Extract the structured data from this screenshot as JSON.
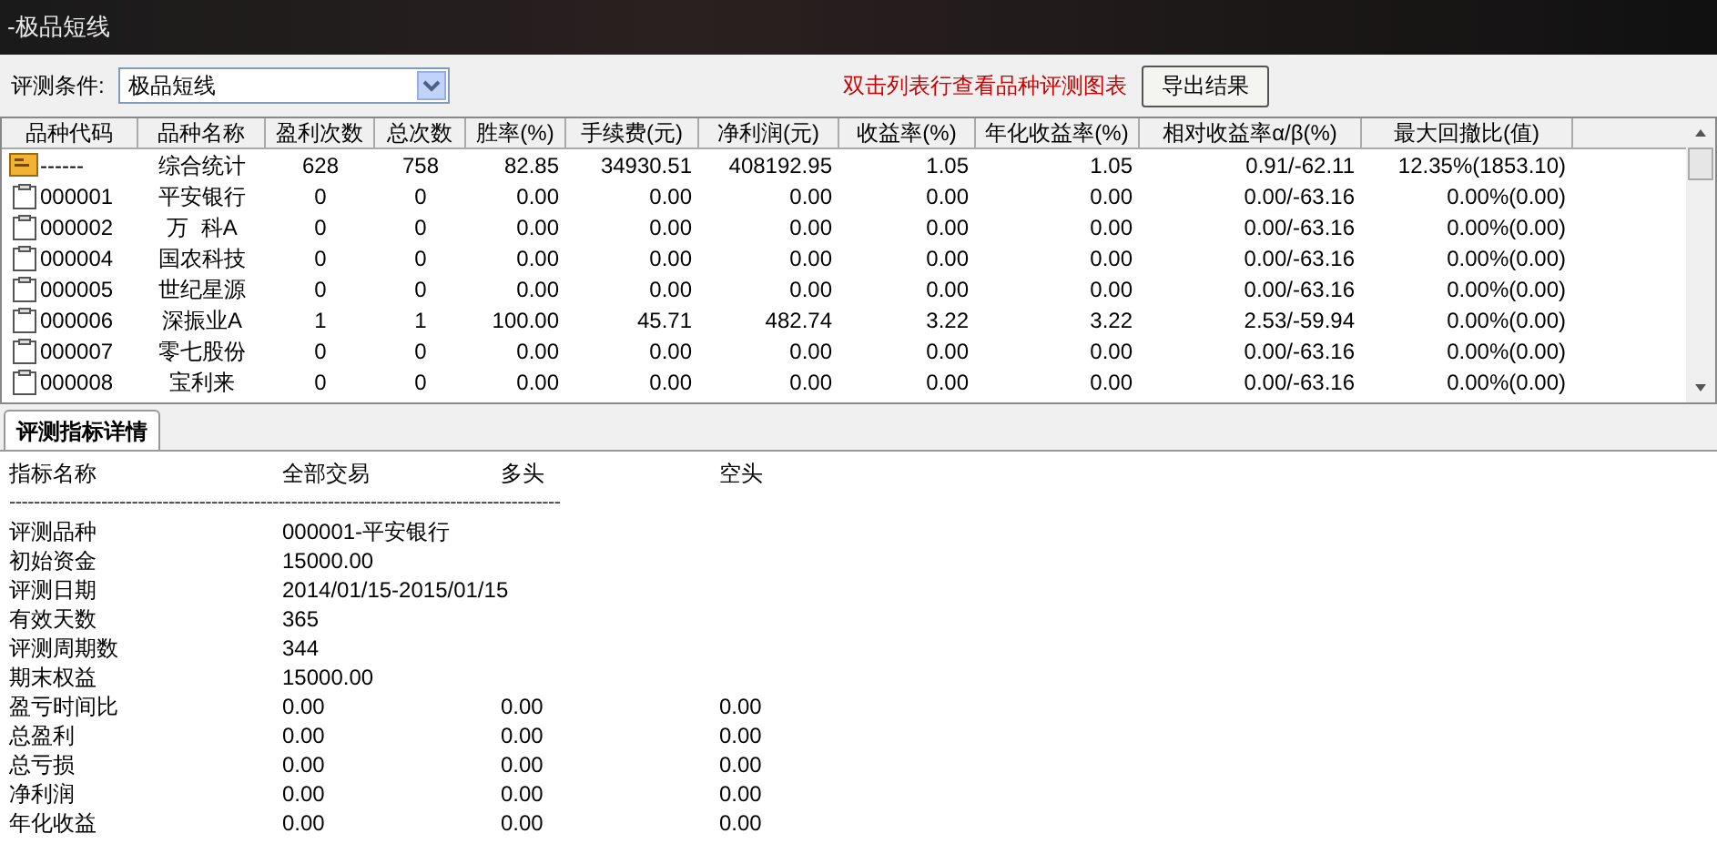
{
  "window": {
    "title": "-极品短线"
  },
  "toolbar": {
    "condition_label": "评测条件:",
    "condition_value": "极品短线",
    "hint": "双击列表行查看品种评测图表",
    "export_button": "导出结果"
  },
  "table": {
    "columns": [
      "品种代码",
      "品种名称",
      "盈利次数",
      "总次数",
      "胜率(%)",
      "手续费(元)",
      "净利润(元)",
      "收益率(%)",
      "年化收益率(%)",
      "相对收益率α/β(%)",
      "最大回撤比(值)"
    ],
    "rows": [
      {
        "kind": "summary",
        "cells": [
          "------",
          "综合统计",
          "628",
          "758",
          "82.85",
          "34930.51",
          "408192.95",
          "1.05",
          "1.05",
          "0.91/-62.11",
          "12.35%(1853.10)"
        ]
      },
      {
        "kind": "stock",
        "cells": [
          "000001",
          "平安银行",
          "0",
          "0",
          "0.00",
          "0.00",
          "0.00",
          "0.00",
          "0.00",
          "0.00/-63.16",
          "0.00%(0.00)"
        ]
      },
      {
        "kind": "stock",
        "cells": [
          "000002",
          "万  科A",
          "0",
          "0",
          "0.00",
          "0.00",
          "0.00",
          "0.00",
          "0.00",
          "0.00/-63.16",
          "0.00%(0.00)"
        ]
      },
      {
        "kind": "stock",
        "cells": [
          "000004",
          "国农科技",
          "0",
          "0",
          "0.00",
          "0.00",
          "0.00",
          "0.00",
          "0.00",
          "0.00/-63.16",
          "0.00%(0.00)"
        ]
      },
      {
        "kind": "stock",
        "cells": [
          "000005",
          "世纪星源",
          "0",
          "0",
          "0.00",
          "0.00",
          "0.00",
          "0.00",
          "0.00",
          "0.00/-63.16",
          "0.00%(0.00)"
        ]
      },
      {
        "kind": "stock",
        "cells": [
          "000006",
          "深振业A",
          "1",
          "1",
          "100.00",
          "45.71",
          "482.74",
          "3.22",
          "3.22",
          "2.53/-59.94",
          "0.00%(0.00)"
        ]
      },
      {
        "kind": "stock",
        "cells": [
          "000007",
          "零七股份",
          "0",
          "0",
          "0.00",
          "0.00",
          "0.00",
          "0.00",
          "0.00",
          "0.00/-63.16",
          "0.00%(0.00)"
        ]
      },
      {
        "kind": "stock",
        "cells": [
          "000008",
          "宝利来",
          "0",
          "0",
          "0.00",
          "0.00",
          "0.00",
          "0.00",
          "0.00",
          "0.00/-63.16",
          "0.00%(0.00)"
        ]
      }
    ]
  },
  "detail_tabs": [
    {
      "label": "评测指标详情",
      "selected": true
    }
  ],
  "detail": {
    "columns": [
      "指标名称",
      "全部交易",
      "多头",
      "空头"
    ],
    "separator": "------------------------------------------------------------------------------------------",
    "rows": [
      [
        "评测品种",
        "000001-平安银行"
      ],
      [
        "初始资金",
        "15000.00"
      ],
      [
        "评测日期",
        "2014/01/15-2015/01/15"
      ],
      [
        "有效天数",
        "365"
      ],
      [
        "评测周期数",
        "344"
      ],
      [
        "期末权益",
        "15000.00"
      ],
      [
        "盈亏时间比",
        "0.00",
        "0.00",
        "0.00"
      ],
      [
        "总盈利",
        "0.00",
        "0.00",
        "0.00"
      ],
      [
        "总亏损",
        "0.00",
        "0.00",
        "0.00"
      ],
      [
        "净利润",
        "0.00",
        "0.00",
        "0.00"
      ],
      [
        "年化收益",
        "0.00",
        "0.00",
        "0.00"
      ]
    ]
  }
}
